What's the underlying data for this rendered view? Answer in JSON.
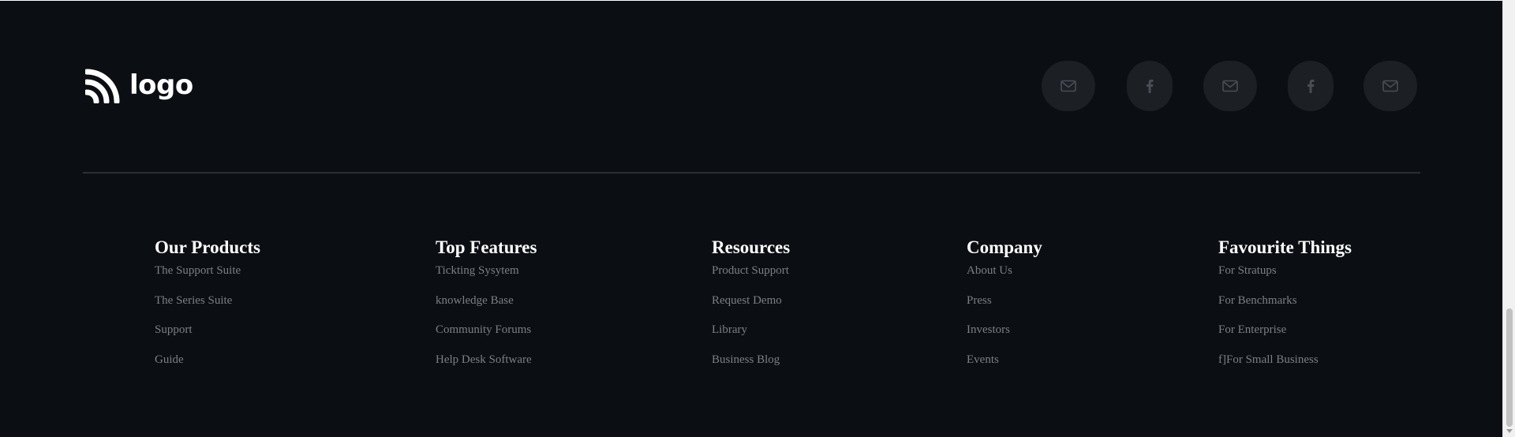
{
  "brand": {
    "logo_text": "logo",
    "logo_color": "#ffffff"
  },
  "social": {
    "bg_color": "#1c1f24",
    "icon_color": "#4a4e55",
    "buttons": [
      {
        "icon": "mail-icon",
        "label": "Email"
      },
      {
        "icon": "facebook-icon",
        "label": "Facebook"
      },
      {
        "icon": "mail-icon",
        "label": "Email"
      },
      {
        "icon": "facebook-icon",
        "label": "Facebook"
      },
      {
        "icon": "mail-icon",
        "label": "Email"
      }
    ]
  },
  "footer": {
    "background_color": "#0b0e13",
    "divider_color": "#2c2f34",
    "link_color": "#7c7f85",
    "columns": [
      {
        "title": "Our Products",
        "links": [
          "The Support Suite",
          "The Series Suite",
          "Support",
          "Guide"
        ]
      },
      {
        "title": "Top Features",
        "links": [
          "Tickting Sysytem",
          "knowledge Base",
          "Community Forums",
          "Help Desk Software"
        ]
      },
      {
        "title": "Resources",
        "links": [
          "Product Support",
          "Request Demo",
          "Library",
          "Business Blog"
        ]
      },
      {
        "title": "Company",
        "links": [
          "About Us",
          "Press",
          "Investors",
          "Events"
        ]
      },
      {
        "title": "Favourite Things",
        "links": [
          "For Stratups",
          "For Benchmarks",
          "For Enterprise",
          "f]For Small Business"
        ]
      }
    ]
  }
}
